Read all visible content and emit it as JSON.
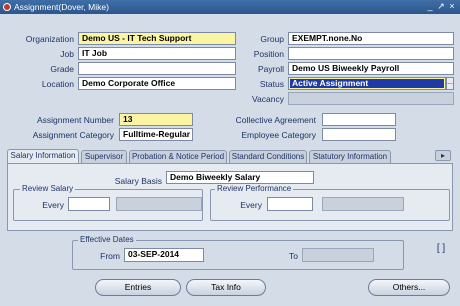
{
  "window": {
    "title": "Assignment(Dover, Mike)",
    "controls": [
      "minimize-icon",
      "maximize-icon",
      "close-icon"
    ]
  },
  "top_form": {
    "organization": {
      "label": "Organization",
      "value": "Demo US - IT Tech Support"
    },
    "job": {
      "label": "Job",
      "value": "IT Job"
    },
    "grade": {
      "label": "Grade",
      "value": ""
    },
    "location": {
      "label": "Location",
      "value": "Demo Corporate Office"
    },
    "group": {
      "label": "Group",
      "value": "EXEMPT.none.No"
    },
    "position": {
      "label": "Position",
      "value": ""
    },
    "payroll": {
      "label": "Payroll",
      "value": "Demo US Biweekly Payroll"
    },
    "status": {
      "label": "Status",
      "value": "Active Assignment"
    },
    "vacancy": {
      "label": "Vacancy",
      "value": ""
    },
    "status_lov": "..."
  },
  "mid_form": {
    "assignment_number": {
      "label": "Assignment Number",
      "value": "13"
    },
    "assignment_category": {
      "label": "Assignment Category",
      "value": "Fulltime-Regular"
    },
    "collective_agreement": {
      "label": "Collective Agreement",
      "value": ""
    },
    "employee_category": {
      "label": "Employee Category",
      "value": ""
    }
  },
  "tabs": [
    {
      "label": "Salary Information",
      "active": true
    },
    {
      "label": "Supervisor",
      "active": false
    },
    {
      "label": "Probation & Notice Period",
      "active": false
    },
    {
      "label": "Standard Conditions",
      "active": false
    },
    {
      "label": "Statutory Information",
      "active": false
    }
  ],
  "tab_scroll": "▸",
  "salary_tab": {
    "salary_basis": {
      "label": "Salary Basis",
      "value": "Demo Biweekly Salary"
    },
    "review_salary": {
      "title": "Review Salary",
      "every_label": "Every",
      "every_value": "",
      "unit_value": ""
    },
    "review_performance": {
      "title": "Review Performance",
      "every_label": "Every",
      "every_value": "",
      "unit_value": ""
    }
  },
  "effective_dates": {
    "title": "Effective Dates",
    "from_label": "From",
    "from_value": "03-SEP-2014",
    "to_label": "To",
    "to_value": ""
  },
  "bracket_indicator": "[ ]",
  "buttons": {
    "entries": "Entries",
    "tax_info": "Tax Info",
    "others": "Others..."
  }
}
